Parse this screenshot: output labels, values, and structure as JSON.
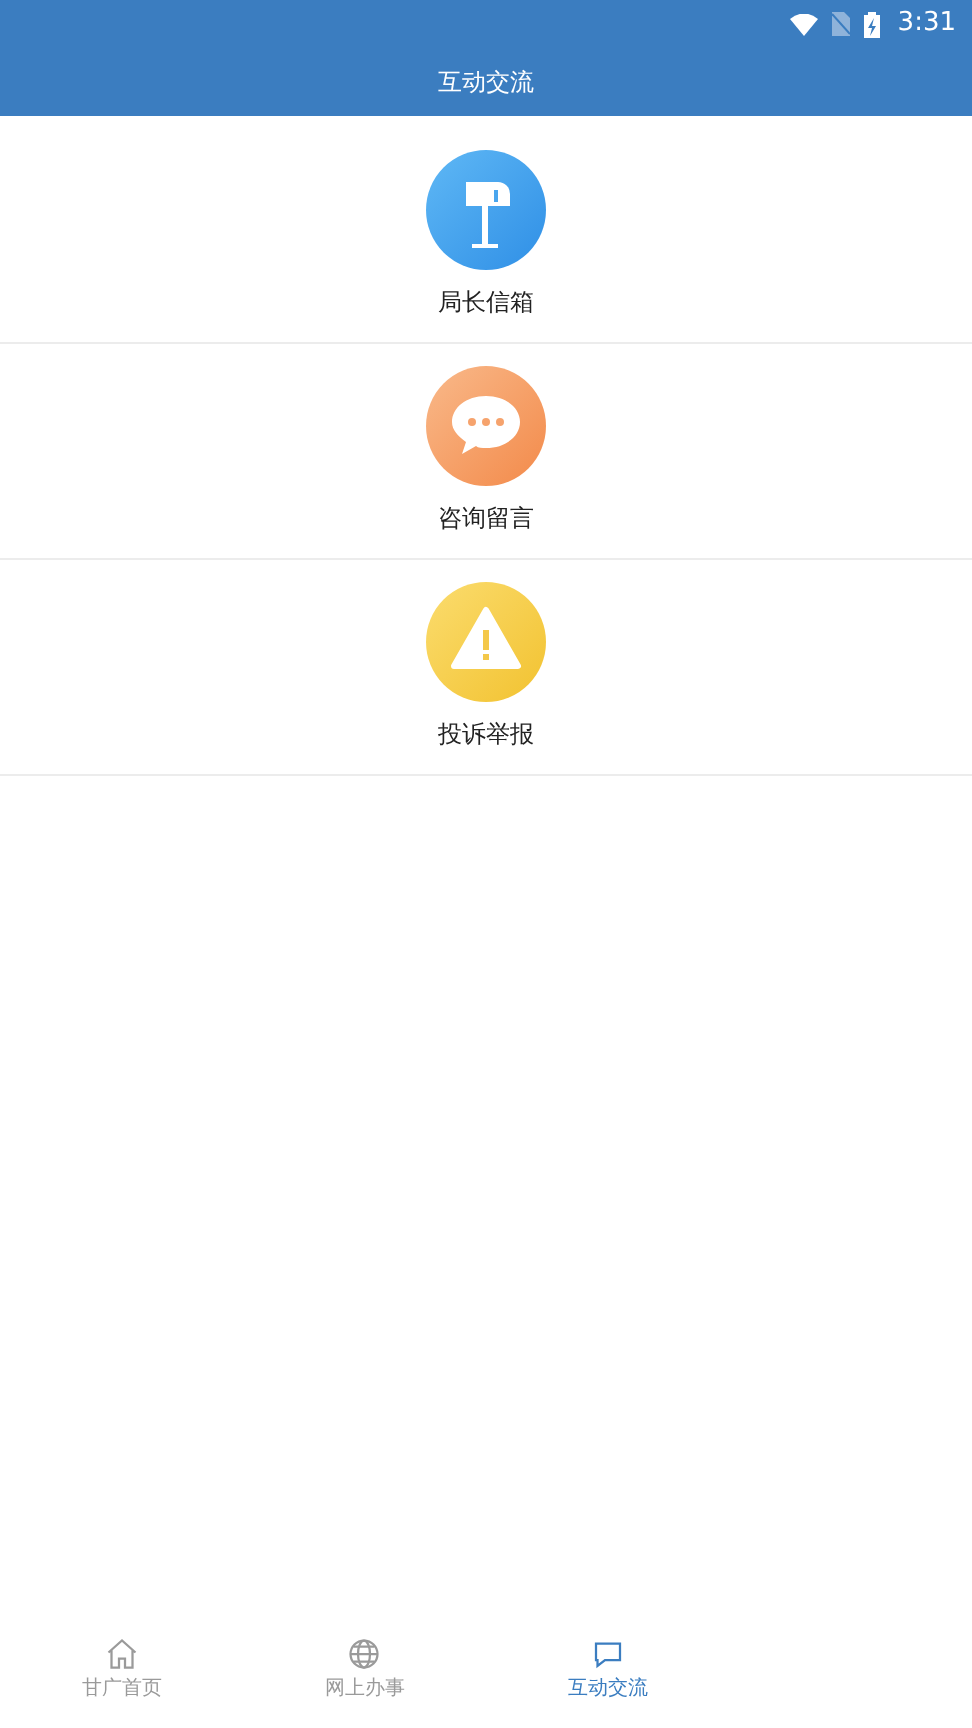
{
  "status_bar": {
    "time": "3:31"
  },
  "header": {
    "title": "互动交流"
  },
  "entries": [
    {
      "kind": "mailbox",
      "label": "局长信箱"
    },
    {
      "kind": "chat",
      "label": "咨询留言"
    },
    {
      "kind": "warning",
      "label": "投诉举报"
    }
  ],
  "tab_bar": [
    {
      "kind": "home",
      "label": "甘广首页",
      "selected": false
    },
    {
      "kind": "globe",
      "label": "网上办事",
      "selected": false
    },
    {
      "kind": "chat",
      "label": "互动交流",
      "selected": true
    }
  ]
}
